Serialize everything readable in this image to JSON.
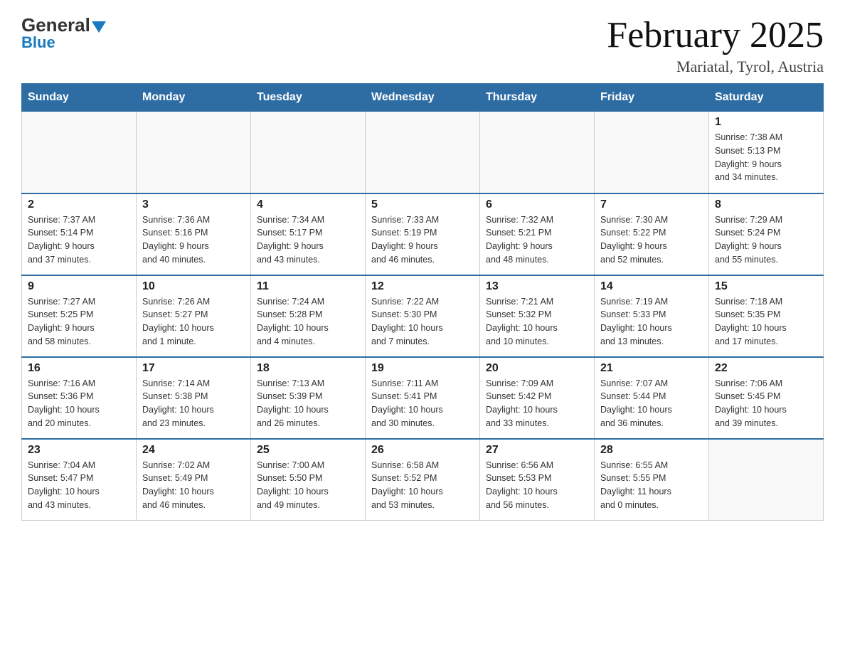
{
  "logo": {
    "text_general": "General",
    "text_blue": "Blue"
  },
  "title": {
    "month": "February 2025",
    "location": "Mariatal, Tyrol, Austria"
  },
  "weekdays": [
    "Sunday",
    "Monday",
    "Tuesday",
    "Wednesday",
    "Thursday",
    "Friday",
    "Saturday"
  ],
  "weeks": [
    [
      {
        "day": "",
        "info": ""
      },
      {
        "day": "",
        "info": ""
      },
      {
        "day": "",
        "info": ""
      },
      {
        "day": "",
        "info": ""
      },
      {
        "day": "",
        "info": ""
      },
      {
        "day": "",
        "info": ""
      },
      {
        "day": "1",
        "info": "Sunrise: 7:38 AM\nSunset: 5:13 PM\nDaylight: 9 hours\nand 34 minutes."
      }
    ],
    [
      {
        "day": "2",
        "info": "Sunrise: 7:37 AM\nSunset: 5:14 PM\nDaylight: 9 hours\nand 37 minutes."
      },
      {
        "day": "3",
        "info": "Sunrise: 7:36 AM\nSunset: 5:16 PM\nDaylight: 9 hours\nand 40 minutes."
      },
      {
        "day": "4",
        "info": "Sunrise: 7:34 AM\nSunset: 5:17 PM\nDaylight: 9 hours\nand 43 minutes."
      },
      {
        "day": "5",
        "info": "Sunrise: 7:33 AM\nSunset: 5:19 PM\nDaylight: 9 hours\nand 46 minutes."
      },
      {
        "day": "6",
        "info": "Sunrise: 7:32 AM\nSunset: 5:21 PM\nDaylight: 9 hours\nand 48 minutes."
      },
      {
        "day": "7",
        "info": "Sunrise: 7:30 AM\nSunset: 5:22 PM\nDaylight: 9 hours\nand 52 minutes."
      },
      {
        "day": "8",
        "info": "Sunrise: 7:29 AM\nSunset: 5:24 PM\nDaylight: 9 hours\nand 55 minutes."
      }
    ],
    [
      {
        "day": "9",
        "info": "Sunrise: 7:27 AM\nSunset: 5:25 PM\nDaylight: 9 hours\nand 58 minutes."
      },
      {
        "day": "10",
        "info": "Sunrise: 7:26 AM\nSunset: 5:27 PM\nDaylight: 10 hours\nand 1 minute."
      },
      {
        "day": "11",
        "info": "Sunrise: 7:24 AM\nSunset: 5:28 PM\nDaylight: 10 hours\nand 4 minutes."
      },
      {
        "day": "12",
        "info": "Sunrise: 7:22 AM\nSunset: 5:30 PM\nDaylight: 10 hours\nand 7 minutes."
      },
      {
        "day": "13",
        "info": "Sunrise: 7:21 AM\nSunset: 5:32 PM\nDaylight: 10 hours\nand 10 minutes."
      },
      {
        "day": "14",
        "info": "Sunrise: 7:19 AM\nSunset: 5:33 PM\nDaylight: 10 hours\nand 13 minutes."
      },
      {
        "day": "15",
        "info": "Sunrise: 7:18 AM\nSunset: 5:35 PM\nDaylight: 10 hours\nand 17 minutes."
      }
    ],
    [
      {
        "day": "16",
        "info": "Sunrise: 7:16 AM\nSunset: 5:36 PM\nDaylight: 10 hours\nand 20 minutes."
      },
      {
        "day": "17",
        "info": "Sunrise: 7:14 AM\nSunset: 5:38 PM\nDaylight: 10 hours\nand 23 minutes."
      },
      {
        "day": "18",
        "info": "Sunrise: 7:13 AM\nSunset: 5:39 PM\nDaylight: 10 hours\nand 26 minutes."
      },
      {
        "day": "19",
        "info": "Sunrise: 7:11 AM\nSunset: 5:41 PM\nDaylight: 10 hours\nand 30 minutes."
      },
      {
        "day": "20",
        "info": "Sunrise: 7:09 AM\nSunset: 5:42 PM\nDaylight: 10 hours\nand 33 minutes."
      },
      {
        "day": "21",
        "info": "Sunrise: 7:07 AM\nSunset: 5:44 PM\nDaylight: 10 hours\nand 36 minutes."
      },
      {
        "day": "22",
        "info": "Sunrise: 7:06 AM\nSunset: 5:45 PM\nDaylight: 10 hours\nand 39 minutes."
      }
    ],
    [
      {
        "day": "23",
        "info": "Sunrise: 7:04 AM\nSunset: 5:47 PM\nDaylight: 10 hours\nand 43 minutes."
      },
      {
        "day": "24",
        "info": "Sunrise: 7:02 AM\nSunset: 5:49 PM\nDaylight: 10 hours\nand 46 minutes."
      },
      {
        "day": "25",
        "info": "Sunrise: 7:00 AM\nSunset: 5:50 PM\nDaylight: 10 hours\nand 49 minutes."
      },
      {
        "day": "26",
        "info": "Sunrise: 6:58 AM\nSunset: 5:52 PM\nDaylight: 10 hours\nand 53 minutes."
      },
      {
        "day": "27",
        "info": "Sunrise: 6:56 AM\nSunset: 5:53 PM\nDaylight: 10 hours\nand 56 minutes."
      },
      {
        "day": "28",
        "info": "Sunrise: 6:55 AM\nSunset: 5:55 PM\nDaylight: 11 hours\nand 0 minutes."
      },
      {
        "day": "",
        "info": ""
      }
    ]
  ]
}
